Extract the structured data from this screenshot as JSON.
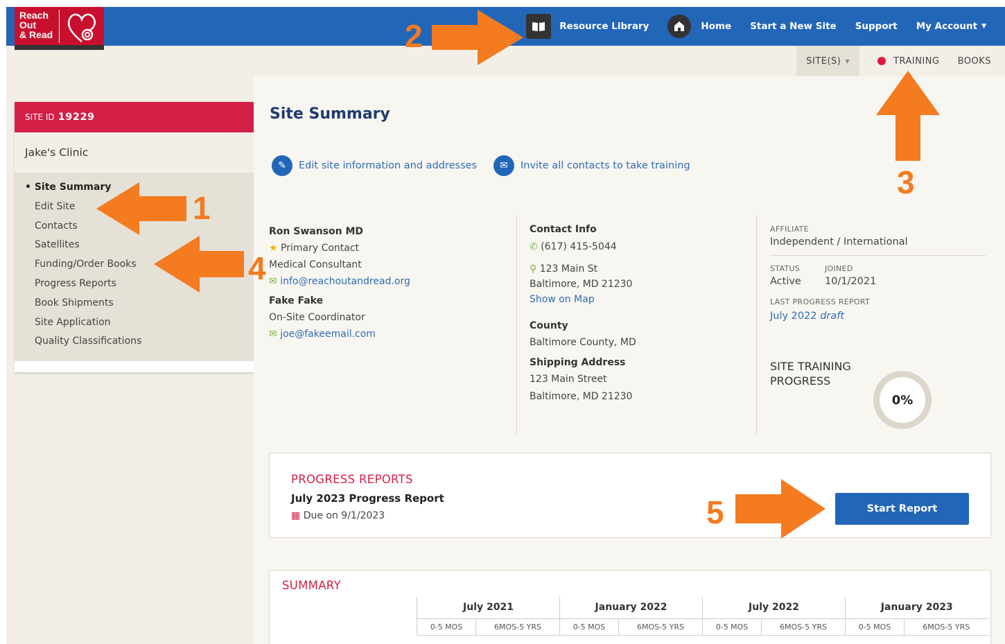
{
  "logo": {
    "text_line1": "Reach",
    "text_line2": "Out",
    "text_line3": "& Read"
  },
  "topnav": {
    "resource_library": "Resource Library",
    "home": "Home",
    "start_new_site": "Start a New Site",
    "support": "Support",
    "my_account": "My Account"
  },
  "subnav": {
    "sites": "SITE(S)",
    "training": "TRAINING",
    "books": "BOOKS"
  },
  "sidebar": {
    "site_id_label": "SITE ID",
    "site_id": "19229",
    "clinic": "Jake's Clinic",
    "items": [
      {
        "label": "Site Summary"
      },
      {
        "label": "Edit Site"
      },
      {
        "label": "Contacts"
      },
      {
        "label": "Satellites"
      },
      {
        "label": "Funding/Order Books"
      },
      {
        "label": "Progress Reports"
      },
      {
        "label": "Book Shipments"
      },
      {
        "label": "Site Application"
      },
      {
        "label": "Quality Classifications"
      }
    ]
  },
  "main": {
    "title": "Site Summary",
    "edit_action": "Edit site information and addresses",
    "invite_action": "Invite all contacts to take training",
    "contacts": {
      "c1_name": "Ron Swanson MD",
      "c1_role1": "Primary Contact",
      "c1_role2": "Medical Consultant",
      "c1_email": "info@reachoutandread.org",
      "c2_name": "Fake Fake",
      "c2_role": "On-Site Coordinator",
      "c2_email": "joe@fakeemail.com"
    },
    "contact_info": {
      "heading": "Contact Info",
      "phone": "(617) 415-5044",
      "street": "123 Main St",
      "city": "Baltimore, MD 21230",
      "map_link": "Show on Map",
      "county_heading": "County",
      "county": "Baltimore County, MD",
      "shipping_heading": "Shipping Address",
      "ship_street": "123 Main Street",
      "ship_city": "Baltimore, MD 21230"
    },
    "affiliate": {
      "label": "AFFILIATE",
      "value": "Independent / International",
      "status_label": "STATUS",
      "status": "Active",
      "joined_label": "JOINED",
      "joined": "10/1/2021",
      "last_report_label": "LAST PROGRESS REPORT",
      "last_report": "July 2022",
      "last_report_state": "draft",
      "training_label_1": "SITE TRAINING",
      "training_label_2": "PROGRESS",
      "training_pct": "0%"
    },
    "progress_reports": {
      "heading": "PROGRESS REPORTS",
      "report_title": "July 2023 Progress Report",
      "due": "Due on 9/1/2023",
      "button": "Start Report"
    },
    "summary": {
      "heading": "SUMMARY",
      "periods": [
        "July 2021",
        "January 2022",
        "July 2022",
        "January 2023"
      ],
      "sub1": "0-5 MOS",
      "sub2": "6MOS-5 YRS"
    }
  },
  "annotations": {
    "n1": "1",
    "n2": "2",
    "n3": "3",
    "n4": "4",
    "n5": "5"
  },
  "colors": {
    "nav_blue": "#2266b8",
    "brand_red": "#d41f47",
    "arrow_orange": "#f47b20"
  }
}
